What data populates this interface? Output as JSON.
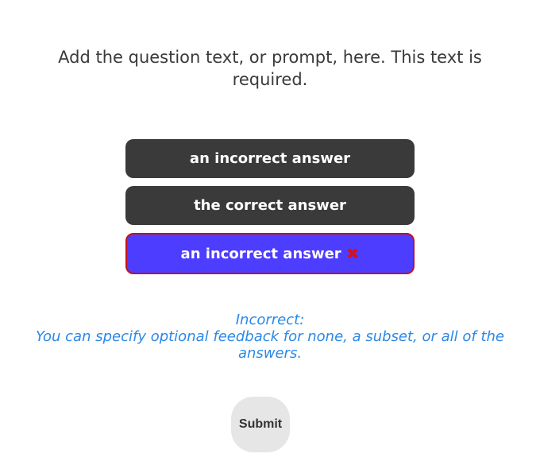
{
  "question": {
    "text": "Add the question text, or prompt, here. This text is required."
  },
  "answers": [
    {
      "label": "an incorrect answer",
      "selected": false
    },
    {
      "label": "the correct answer",
      "selected": false
    },
    {
      "label": "an incorrect answer",
      "selected": true,
      "icon": "x-icon"
    }
  ],
  "feedback": {
    "heading": "Incorrect:",
    "text": "You can specify optional feedback for none, a subset, or all of the answers."
  },
  "submit": {
    "label": "Submit"
  },
  "colors": {
    "answer_bg": "#3a3a3a",
    "selected_bg": "#4d3dff",
    "selected_border": "#c1121f",
    "feedback": "#2b88e8",
    "submit_bg": "#e6e6e6"
  }
}
